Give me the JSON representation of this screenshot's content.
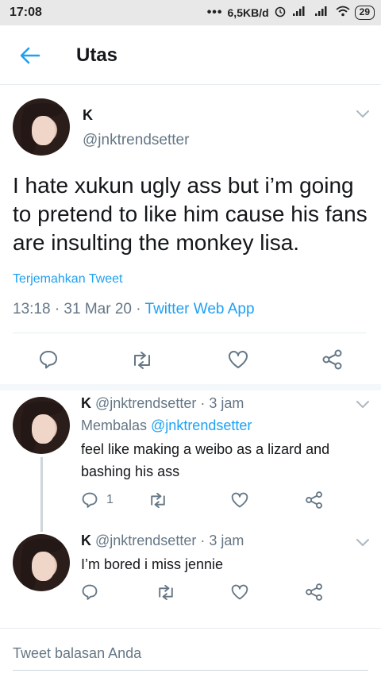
{
  "status_bar": {
    "time": "17:08",
    "dots": "•••",
    "speed": "6,5KB/d",
    "battery": "29"
  },
  "header": {
    "back_icon": "arrow-left-icon",
    "title": "Utas"
  },
  "main_tweet": {
    "name": "K",
    "handle": "@jnktrendsetter",
    "text": "I hate xukun ugly ass but i’m going to pretend to like him cause his fans are insulting the monkey lisa.",
    "translate": "Terjemahkan Tweet",
    "timestamp": "13:18 · 31 Mar 20 · ",
    "source": "Twitter Web App"
  },
  "replies": [
    {
      "name": "K",
      "handle_time": " @jnktrendsetter · 3 jam",
      "replying_prefix": "Membalas ",
      "replying_to": "@jnktrendsetter",
      "text": "feel like making a weibo as a lizard and bashing his ass",
      "reply_count": "1"
    },
    {
      "name": "K",
      "handle_time": " @jnktrendsetter · 3 jam",
      "text": "I’m bored i miss jennie",
      "reply_count": ""
    }
  ],
  "compose": {
    "placeholder": "Tweet balasan Anda"
  },
  "colors": {
    "accent": "#1da1f2",
    "secondary_text": "#657786",
    "divider": "#e6ecf0"
  }
}
